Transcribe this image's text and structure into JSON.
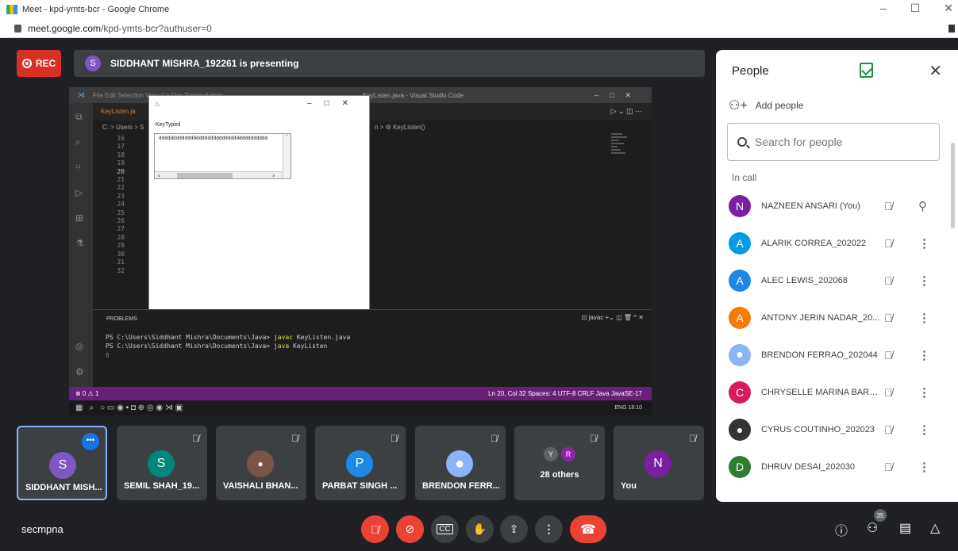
{
  "browser": {
    "window_title": "Meet - kpd-ymts-bcr - Google Chrome",
    "url_host": "meet.google.com",
    "url_path": "/kpd-ymts-bcr?authuser=0"
  },
  "header": {
    "rec_label": "REC",
    "presenter_initial": "S",
    "presenting_text": "SIDDHANT MISHRA_192261 is presenting"
  },
  "shared_screen": {
    "vscode_menu": "File   Edit   Selection   View   Go   Run   Terminal   Help",
    "vscode_title": "KeyListen.java - Visual Studio Code",
    "tab_label": "KeyListen.ja",
    "breadcrumb_left": "C: > Users > S",
    "breadcrumb_right": "n > ⚙ KeyListen()",
    "line_numbers": [
      "16",
      "17",
      "18",
      "19",
      "20",
      "21",
      "22",
      "23",
      "24",
      "25",
      "26",
      "27",
      "28",
      "29",
      "30",
      "31",
      "32"
    ],
    "jframe_label": "KeyTyped",
    "jframe_text": "dddddddddddddddddddddddddddddddddddddd",
    "terminal_tab": "PROBLEMS",
    "terminal_right": "javac",
    "term_line1_prefix": "PS C:\\Users\\Siddhant Mishra\\Documents\\Java> ",
    "term_line1_cmd": "javac",
    "term_line1_arg": " KeyListen.java",
    "term_line2_prefix": "PS C:\\Users\\Siddhant Mishra\\Documents\\Java> ",
    "term_line2_cmd": "java",
    "term_line2_arg": " KeyListen",
    "status_left": "⊗ 0 ⚠ 1",
    "status_right": "Ln 20, Col 32   Spaces: 4   UTF-8   CRLF   Java   JavaSE-17",
    "tray": "ENG  18:10"
  },
  "people_panel": {
    "title": "People",
    "add_people": "Add people",
    "search_placeholder": "Search for people",
    "section_label": "In call",
    "participants": [
      {
        "initial": "N",
        "name": "NAZNEEN ANSARI (You)",
        "color": "#7b1fa2"
      },
      {
        "initial": "A",
        "name": "ALARIK CORREA_202022",
        "color": "#039be5"
      },
      {
        "initial": "A",
        "name": "ALEC LEWIS_202068",
        "color": "#1e88e5"
      },
      {
        "initial": "A",
        "name": "ANTONY JERIN NADAR_20...",
        "color": "#f57c00"
      },
      {
        "initial": "",
        "name": "BRENDON FERRAO_202044",
        "color": "#8ab4f8"
      },
      {
        "initial": "C",
        "name": "CHRYSELLE MARINA BARR...",
        "color": "#d81b60"
      },
      {
        "initial": "",
        "name": "CYRUS COUTINHO_202023",
        "color": "#333333"
      },
      {
        "initial": "D",
        "name": "DHRUV DESAI_202030",
        "color": "#2e7d32"
      }
    ]
  },
  "tiles": [
    {
      "initial": "S",
      "label": "SIDDHANT MISH...",
      "color": "#7e57c2"
    },
    {
      "initial": "S",
      "label": "SEMIL SHAH_19...",
      "color": "#00897b"
    },
    {
      "initial": "",
      "label": "VAISHALI BHAN...",
      "color": "#795548"
    },
    {
      "initial": "P",
      "label": "PARBAT SINGH ...",
      "color": "#1e88e5"
    },
    {
      "initial": "",
      "label": "BRENDON FERR...",
      "color": "#8ab4f8"
    },
    {
      "initial": "",
      "label": "",
      "others": "28 others",
      "mini": [
        "Y",
        "R"
      ]
    },
    {
      "initial": "N",
      "label": "You",
      "color": "#7b1fa2"
    }
  ],
  "footer": {
    "meeting_code": "secmpna",
    "participant_count": "35"
  }
}
